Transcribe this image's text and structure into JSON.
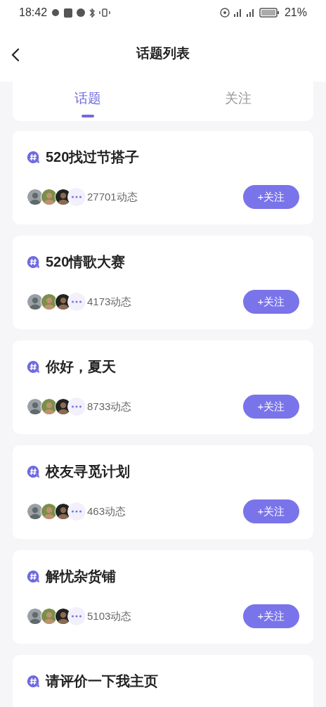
{
  "status_bar": {
    "time": "18:42",
    "battery": "21%"
  },
  "header": {
    "title": "话题列表"
  },
  "tabs": [
    {
      "label": "话题",
      "selected": true
    },
    {
      "label": "关注",
      "selected": false
    }
  ],
  "topics": [
    {
      "title": "520找过节搭子",
      "count": "27701动态",
      "button": "+关注"
    },
    {
      "title": "520情歌大赛",
      "count": "4173动态",
      "button": "+关注"
    },
    {
      "title": "你好，夏天",
      "count": "8733动态",
      "button": "+关注"
    },
    {
      "title": "校友寻觅计划",
      "count": "463动态",
      "button": "+关注"
    },
    {
      "title": "解忧杂货铺",
      "count": "5103动态",
      "button": "+关注"
    },
    {
      "title": "请评价一下我主页"
    }
  ]
}
